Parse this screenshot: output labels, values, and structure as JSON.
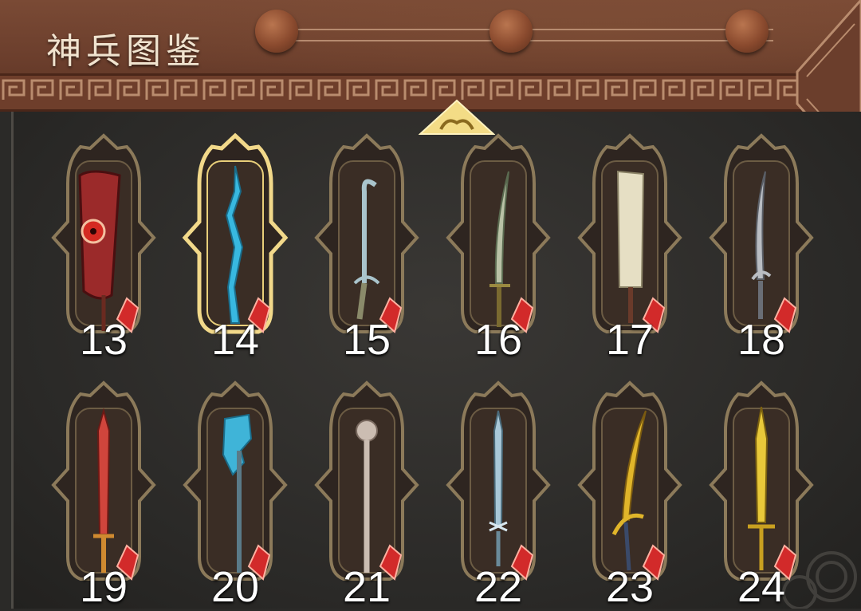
{
  "header": {
    "title": "神兵图鉴"
  },
  "colors": {
    "header_brown": "#6b3e2c",
    "panel_dark": "#2b2a28",
    "frame_gold": "#8c7a5a",
    "selected_gold": "#f2d98a",
    "gem_red": "#d22a2a"
  },
  "scroll_up_icon": "chevron-up-ornate",
  "selected_index": 14,
  "weapons": [
    {
      "num": "13",
      "icon": "demon-eye-blade-icon",
      "color": "#9b2a2a"
    },
    {
      "num": "14",
      "icon": "ice-crystal-sword-icon",
      "color": "#38b8e0"
    },
    {
      "num": "15",
      "icon": "hook-sword-icon",
      "color": "#a9c4cc"
    },
    {
      "num": "16",
      "icon": "curved-saber-icon",
      "color": "#b9c2a6"
    },
    {
      "num": "17",
      "icon": "broad-cleaver-icon",
      "color": "#e6dfc4"
    },
    {
      "num": "18",
      "icon": "steel-hook-blade-icon",
      "color": "#b9bdc3"
    },
    {
      "num": "19",
      "icon": "crimson-jian-icon",
      "color": "#d0453c"
    },
    {
      "num": "20",
      "icon": "crystal-halberd-icon",
      "color": "#3fb4d8"
    },
    {
      "num": "21",
      "icon": "silver-mace-icon",
      "color": "#cbbdb2"
    },
    {
      "num": "22",
      "icon": "frost-rapier-icon",
      "color": "#a9c8d8"
    },
    {
      "num": "23",
      "icon": "golden-saber-icon",
      "color": "#e0b52a"
    },
    {
      "num": "24",
      "icon": "golden-jian-icon",
      "color": "#e8c83a"
    }
  ]
}
